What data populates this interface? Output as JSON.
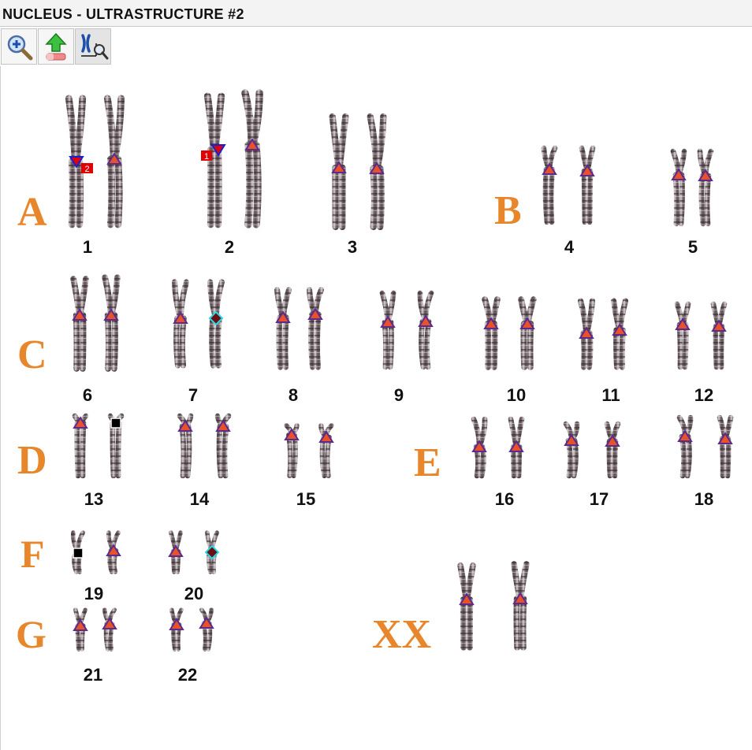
{
  "window": {
    "title": "NUCLEUS - ULTRASTRUCTURE #2"
  },
  "toolbar": {
    "buttons": [
      {
        "name": "zoom-in-button",
        "icon": "magnifier-plus-icon"
      },
      {
        "name": "upload-erase-button",
        "icon": "green-up-arrow-eraser-icon"
      },
      {
        "name": "compare-analyze-button",
        "icon": "chromosome-magnifier-icon"
      }
    ]
  },
  "groups": {
    "A": "A",
    "B": "B",
    "C": "C",
    "D": "D",
    "E": "E",
    "F": "F",
    "G": "G",
    "XX": "XX"
  },
  "chromosome_numbers": {
    "c1": "1",
    "c2": "2",
    "c3": "3",
    "c4": "4",
    "c5": "5",
    "c6": "6",
    "c7": "7",
    "c8": "8",
    "c9": "9",
    "c10": "10",
    "c11": "11",
    "c12": "12",
    "c13": "13",
    "c14": "14",
    "c15": "15",
    "c16": "16",
    "c17": "17",
    "c18": "18",
    "c19": "19",
    "c20": "20",
    "c21": "21",
    "c22": "22"
  },
  "annotations": {
    "flag1": "1",
    "flag2": "2"
  },
  "colors": {
    "group_letter": "#e8862c",
    "centromere_marker": "#e8522a",
    "marker_outline": "#5b2a8a",
    "flag": "#e00000",
    "diamond_fill": "#6b1010",
    "diamond_outline": "#28d8e8"
  }
}
